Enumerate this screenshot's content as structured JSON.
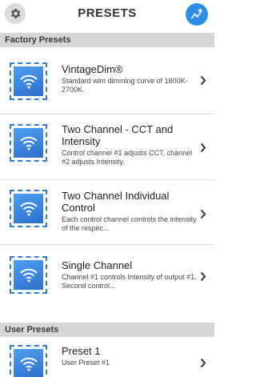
{
  "header": {
    "title": "PRESETS",
    "settings_icon": "gear-icon",
    "add_icon": "add-preset-icon"
  },
  "sections": {
    "factory": "Factory Presets",
    "user": "User Presets"
  },
  "factory_presets": [
    {
      "title": "VintageDim®",
      "description": "Standard wim dimming curve of 1800K-2700K."
    },
    {
      "title": "Two Channel - CCT and Intensity",
      "description": "Control channel #1 adjusts CCT, channel #2 adjusts Intensity."
    },
    {
      "title": "Two Channel Individual Control",
      "description": "Each control channel controls the intensity of the respec..."
    },
    {
      "title": "Single Channel",
      "description": "Channel #1 controls Intensity of output #1. Second control..."
    }
  ],
  "user_presets": [
    {
      "title": "Preset 1",
      "description": "User Preset #1"
    }
  ],
  "colors": {
    "accent": "#2e8ee6",
    "section_bg": "#d6d6d6",
    "icon_gradient_top": "#4e9ff0",
    "icon_gradient_bottom": "#2d6fcb"
  }
}
